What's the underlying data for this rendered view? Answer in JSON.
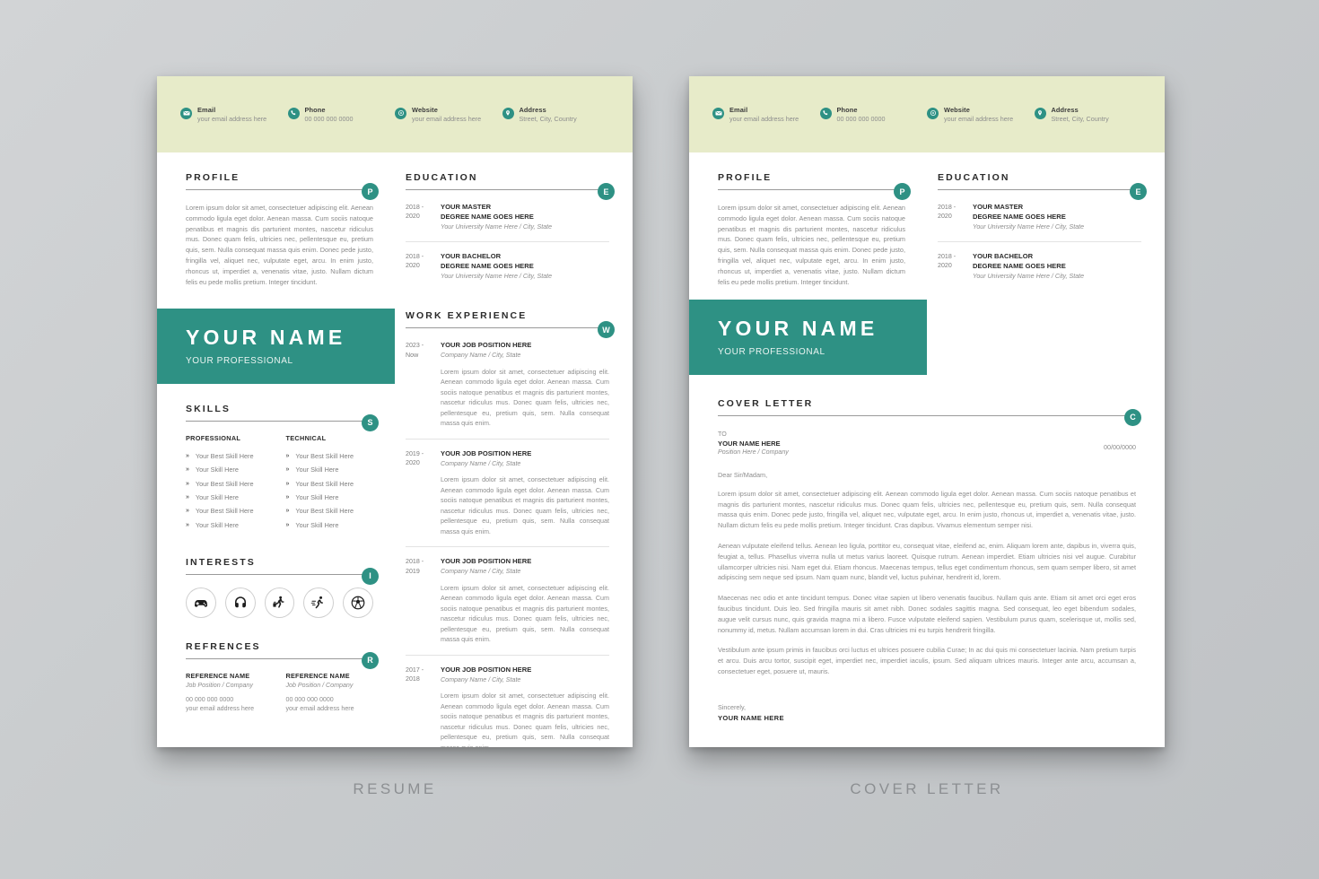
{
  "accent_color": "#2e9184",
  "header_band_color": "#e7ebc9",
  "page_background": "#ffffff",
  "captions": {
    "resume": "RESUME",
    "cover_letter": "COVER LETTER"
  },
  "contact": [
    {
      "icon": "email-icon",
      "label": "Email",
      "value": "your email address here"
    },
    {
      "icon": "phone-icon",
      "label": "Phone",
      "value": "00 000 000 0000"
    },
    {
      "icon": "website-icon",
      "label": "Website",
      "value": "your email address here"
    },
    {
      "icon": "address-icon",
      "label": "Address",
      "value": "Street, City, Country"
    }
  ],
  "profile": {
    "title": "PROFILE",
    "badge": "P",
    "text": "Lorem ipsum dolor sit amet, consectetuer adipiscing elit. Aenean commodo ligula eget dolor. Aenean massa. Cum sociis natoque penatibus et magnis dis parturient montes, nascetur ridiculus mus. Donec quam felis, ultricies nec, pellentesque eu, pretium quis, sem. Nulla consequat massa quis enim. Donec pede justo, fringilla vel, aliquet nec, vulputate eget, arcu. In enim justo, rhoncus ut, imperdiet a, venenatis vitae, justo. Nullam dictum felis eu pede mollis pretium. Integer tincidunt."
  },
  "education": {
    "title": "EDUCATION",
    "badge": "E",
    "entries": [
      {
        "date_from": "2018 -",
        "date_to": "2020",
        "line1": "YOUR MASTER",
        "line2": "DEGREE NAME GOES HERE",
        "sub": "Your University Name Here / City, State"
      },
      {
        "date_from": "2018 -",
        "date_to": "2020",
        "line1": "YOUR BACHELOR",
        "line2": "DEGREE NAME GOES HERE",
        "sub": "Your University Name Here / City, State"
      }
    ]
  },
  "name_block": {
    "name": "YOUR NAME",
    "profession": "YOUR PROFESSIONAL"
  },
  "work_experience": {
    "title": "WORK EXPERIENCE",
    "badge": "W",
    "entries": [
      {
        "date_from": "2023 -",
        "date_to": "Now",
        "position": "YOUR JOB POSITION HERE",
        "company": "Company Name / City, State",
        "description": "Lorem ipsum dolor sit amet, consectetuer adipiscing elit. Aenean commodo ligula eget dolor. Aenean massa. Cum sociis natoque penatibus et magnis dis parturient montes, nascetur ridiculus mus. Donec quam felis, ultricies nec, pellentesque eu, pretium quis, sem. Nulla consequat massa quis enim."
      },
      {
        "date_from": "2019 -",
        "date_to": "2020",
        "position": "YOUR JOB POSITION HERE",
        "company": "Company Name / City, State",
        "description": "Lorem ipsum dolor sit amet, consectetuer adipiscing elit. Aenean commodo ligula eget dolor. Aenean massa. Cum sociis natoque penatibus et magnis dis parturient montes, nascetur ridiculus mus. Donec quam felis, ultricies nec, pellentesque eu, pretium quis, sem. Nulla consequat massa quis enim."
      },
      {
        "date_from": "2018 -",
        "date_to": "2019",
        "position": "YOUR JOB POSITION HERE",
        "company": "Company Name / City, State",
        "description": "Lorem ipsum dolor sit amet, consectetuer adipiscing elit. Aenean commodo ligula eget dolor. Aenean massa. Cum sociis natoque penatibus et magnis dis parturient montes, nascetur ridiculus mus. Donec quam felis, ultricies nec, pellentesque eu, pretium quis, sem. Nulla consequat massa quis enim."
      },
      {
        "date_from": "2017 -",
        "date_to": "2018",
        "position": "YOUR JOB POSITION HERE",
        "company": "Company Name / City, State",
        "description": "Lorem ipsum dolor sit amet, consectetuer adipiscing elit. Aenean commodo ligula eget dolor. Aenean massa. Cum sociis natoque penatibus et magnis dis parturient montes, nascetur ridiculus mus. Donec quam felis, ultricies nec, pellentesque eu, pretium quis, sem. Nulla consequat massa quis enim."
      }
    ]
  },
  "skills": {
    "title": "SKILLS",
    "badge": "S",
    "bullet": "»",
    "columns": [
      {
        "heading": "PROFESSIONAL",
        "items": [
          "Your Best Skill Here",
          "Your Skill Here",
          "Your Best Skill Here",
          "Your Skill Here",
          "Your Best Skill Here",
          "Your Skill Here"
        ]
      },
      {
        "heading": "TECHNICAL",
        "items": [
          "Your Best Skill Here",
          "Your Skill Here",
          "Your Best Skill Here",
          "Your Skill Here",
          "Your Best Skill Here",
          "Your Skill Here"
        ]
      }
    ]
  },
  "interests": {
    "title": "INTERESTS",
    "badge": "I",
    "icons": [
      "gamepad-icon",
      "headphones-icon",
      "traveler-luggage-icon",
      "running-person-icon",
      "soccer-ball-icon"
    ]
  },
  "references": {
    "title": "REFRENCES",
    "badge": "R",
    "items": [
      {
        "name": "REFERENCE NAME",
        "position": "Job Position / Company",
        "phone": "00 000 000 0000",
        "email": "your email address here"
      },
      {
        "name": "REFERENCE NAME",
        "position": "Job Position / Company",
        "phone": "00 000 000 0000",
        "email": "your email address here"
      }
    ]
  },
  "cover_letter": {
    "title": "COVER LETTER",
    "badge": "C",
    "to_label": "TO",
    "to_name": "YOUR NAME HERE",
    "to_position": "Position Here / Company",
    "date": "00/00/0000",
    "greeting": "Dear Sir/Madam,",
    "paragraphs": [
      "Lorem ipsum dolor sit amet, consectetuer adipiscing elit. Aenean commodo ligula eget dolor. Aenean massa. Cum sociis natoque penatibus et magnis dis parturient montes, nascetur ridiculus mus. Donec quam felis, ultricies nec, pellentesque eu, pretium quis, sem. Nulla consequat massa quis enim. Donec pede justo, fringilla vel, aliquet nec, vulputate eget, arcu. In enim justo, rhoncus ut, imperdiet a, venenatis vitae, justo. Nullam dictum felis eu pede mollis pretium. Integer tincidunt. Cras dapibus. Vivamus elementum semper nisi.",
      "Aenean vulputate eleifend tellus. Aenean leo ligula, porttitor eu, consequat vitae, eleifend ac, enim. Aliquam lorem ante, dapibus in, viverra quis, feugiat a, tellus. Phasellus viverra nulla ut metus varius laoreet. Quisque rutrum. Aenean imperdiet. Etiam ultricies nisi vel augue. Curabitur ullamcorper ultricies nisi. Nam eget dui. Etiam rhoncus. Maecenas tempus, tellus eget condimentum rhoncus, sem quam semper libero, sit amet adipiscing sem neque sed ipsum. Nam quam nunc, blandit vel, luctus pulvinar, hendrerit id, lorem.",
      "Maecenas nec odio et ante tincidunt tempus. Donec vitae sapien ut libero venenatis faucibus. Nullam quis ante. Etiam sit amet orci eget eros faucibus tincidunt. Duis leo. Sed fringilla mauris sit amet nibh. Donec sodales sagittis magna. Sed consequat, leo eget bibendum sodales, augue velit cursus nunc, quis gravida magna mi a libero. Fusce vulputate eleifend sapien. Vestibulum purus quam, scelerisque ut, mollis sed, nonummy id, metus. Nullam accumsan lorem in dui. Cras ultricies mi eu turpis hendrerit fringilla.",
      "Vestibulum ante ipsum primis in faucibus orci luctus et ultrices posuere cubilia Curae; In ac dui quis mi consectetuer lacinia. Nam pretium turpis et arcu. Duis arcu tortor, suscipit eget, imperdiet nec, imperdiet iaculis, ipsum. Sed aliquam ultrices mauris. Integer ante arcu, accumsan a, consectetuer eget, posuere ut, mauris."
    ],
    "sign_off": "Sincerely,",
    "sign_name": "YOUR NAME HERE"
  }
}
